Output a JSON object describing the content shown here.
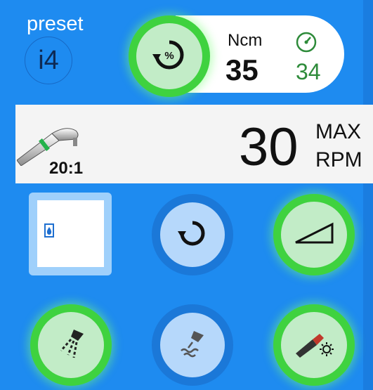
{
  "preset": {
    "label": "preset",
    "value": "i4"
  },
  "torque": {
    "unit_label": "Ncm",
    "value": "35",
    "measured": "34",
    "button_icon": "torque-percent-icon",
    "gauge_icon": "gauge-icon"
  },
  "speed": {
    "ratio": "20:1",
    "value": "30",
    "max_label": "MAX",
    "unit_label": "RPM",
    "handpiece_icon": "handpiece-icon"
  },
  "buttons": {
    "water": {
      "icon": "water-drop-icon",
      "active": true
    },
    "direction": {
      "icon": "reverse-rotation-icon",
      "active": false
    },
    "ramp": {
      "icon": "ramp-icon",
      "active": true
    },
    "spray": {
      "icon": "spray-icon",
      "active": true
    },
    "irrigation": {
      "icon": "irrigation-icon",
      "active": false
    },
    "light": {
      "icon": "handpiece-light-icon",
      "active": true
    }
  },
  "colors": {
    "background": "#1e8bf0",
    "active_ring": "#3fd23f",
    "active_fill": "#c2ecc7",
    "inactive_fill": "#b6d8fb",
    "measured_text": "#2e8b3a"
  }
}
